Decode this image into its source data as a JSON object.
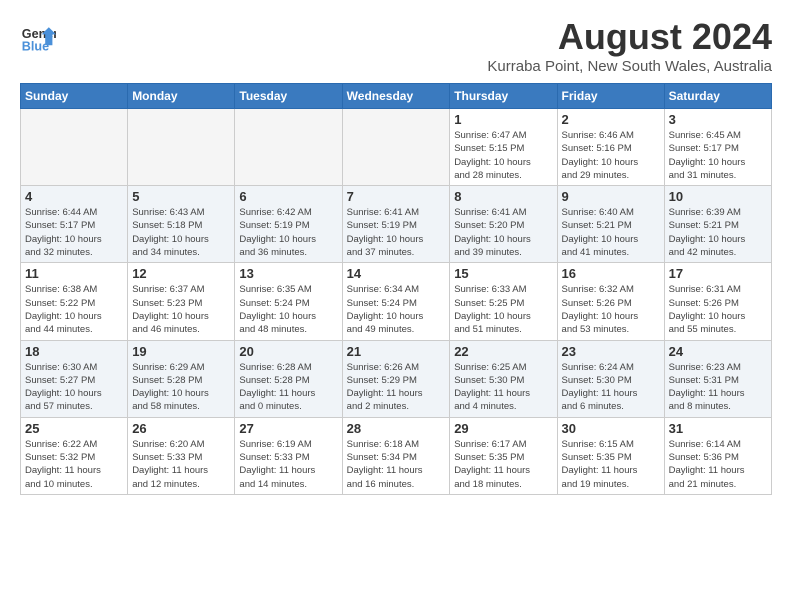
{
  "header": {
    "logo_line1": "General",
    "logo_line2": "Blue",
    "main_title": "August 2024",
    "subtitle": "Kurraba Point, New South Wales, Australia"
  },
  "calendar": {
    "days_of_week": [
      "Sunday",
      "Monday",
      "Tuesday",
      "Wednesday",
      "Thursday",
      "Friday",
      "Saturday"
    ],
    "weeks": [
      [
        {
          "day": "",
          "info": ""
        },
        {
          "day": "",
          "info": ""
        },
        {
          "day": "",
          "info": ""
        },
        {
          "day": "",
          "info": ""
        },
        {
          "day": "1",
          "info": "Sunrise: 6:47 AM\nSunset: 5:15 PM\nDaylight: 10 hours\nand 28 minutes."
        },
        {
          "day": "2",
          "info": "Sunrise: 6:46 AM\nSunset: 5:16 PM\nDaylight: 10 hours\nand 29 minutes."
        },
        {
          "day": "3",
          "info": "Sunrise: 6:45 AM\nSunset: 5:17 PM\nDaylight: 10 hours\nand 31 minutes."
        }
      ],
      [
        {
          "day": "4",
          "info": "Sunrise: 6:44 AM\nSunset: 5:17 PM\nDaylight: 10 hours\nand 32 minutes."
        },
        {
          "day": "5",
          "info": "Sunrise: 6:43 AM\nSunset: 5:18 PM\nDaylight: 10 hours\nand 34 minutes."
        },
        {
          "day": "6",
          "info": "Sunrise: 6:42 AM\nSunset: 5:19 PM\nDaylight: 10 hours\nand 36 minutes."
        },
        {
          "day": "7",
          "info": "Sunrise: 6:41 AM\nSunset: 5:19 PM\nDaylight: 10 hours\nand 37 minutes."
        },
        {
          "day": "8",
          "info": "Sunrise: 6:41 AM\nSunset: 5:20 PM\nDaylight: 10 hours\nand 39 minutes."
        },
        {
          "day": "9",
          "info": "Sunrise: 6:40 AM\nSunset: 5:21 PM\nDaylight: 10 hours\nand 41 minutes."
        },
        {
          "day": "10",
          "info": "Sunrise: 6:39 AM\nSunset: 5:21 PM\nDaylight: 10 hours\nand 42 minutes."
        }
      ],
      [
        {
          "day": "11",
          "info": "Sunrise: 6:38 AM\nSunset: 5:22 PM\nDaylight: 10 hours\nand 44 minutes."
        },
        {
          "day": "12",
          "info": "Sunrise: 6:37 AM\nSunset: 5:23 PM\nDaylight: 10 hours\nand 46 minutes."
        },
        {
          "day": "13",
          "info": "Sunrise: 6:35 AM\nSunset: 5:24 PM\nDaylight: 10 hours\nand 48 minutes."
        },
        {
          "day": "14",
          "info": "Sunrise: 6:34 AM\nSunset: 5:24 PM\nDaylight: 10 hours\nand 49 minutes."
        },
        {
          "day": "15",
          "info": "Sunrise: 6:33 AM\nSunset: 5:25 PM\nDaylight: 10 hours\nand 51 minutes."
        },
        {
          "day": "16",
          "info": "Sunrise: 6:32 AM\nSunset: 5:26 PM\nDaylight: 10 hours\nand 53 minutes."
        },
        {
          "day": "17",
          "info": "Sunrise: 6:31 AM\nSunset: 5:26 PM\nDaylight: 10 hours\nand 55 minutes."
        }
      ],
      [
        {
          "day": "18",
          "info": "Sunrise: 6:30 AM\nSunset: 5:27 PM\nDaylight: 10 hours\nand 57 minutes."
        },
        {
          "day": "19",
          "info": "Sunrise: 6:29 AM\nSunset: 5:28 PM\nDaylight: 10 hours\nand 58 minutes."
        },
        {
          "day": "20",
          "info": "Sunrise: 6:28 AM\nSunset: 5:28 PM\nDaylight: 11 hours\nand 0 minutes."
        },
        {
          "day": "21",
          "info": "Sunrise: 6:26 AM\nSunset: 5:29 PM\nDaylight: 11 hours\nand 2 minutes."
        },
        {
          "day": "22",
          "info": "Sunrise: 6:25 AM\nSunset: 5:30 PM\nDaylight: 11 hours\nand 4 minutes."
        },
        {
          "day": "23",
          "info": "Sunrise: 6:24 AM\nSunset: 5:30 PM\nDaylight: 11 hours\nand 6 minutes."
        },
        {
          "day": "24",
          "info": "Sunrise: 6:23 AM\nSunset: 5:31 PM\nDaylight: 11 hours\nand 8 minutes."
        }
      ],
      [
        {
          "day": "25",
          "info": "Sunrise: 6:22 AM\nSunset: 5:32 PM\nDaylight: 11 hours\nand 10 minutes."
        },
        {
          "day": "26",
          "info": "Sunrise: 6:20 AM\nSunset: 5:33 PM\nDaylight: 11 hours\nand 12 minutes."
        },
        {
          "day": "27",
          "info": "Sunrise: 6:19 AM\nSunset: 5:33 PM\nDaylight: 11 hours\nand 14 minutes."
        },
        {
          "day": "28",
          "info": "Sunrise: 6:18 AM\nSunset: 5:34 PM\nDaylight: 11 hours\nand 16 minutes."
        },
        {
          "day": "29",
          "info": "Sunrise: 6:17 AM\nSunset: 5:35 PM\nDaylight: 11 hours\nand 18 minutes."
        },
        {
          "day": "30",
          "info": "Sunrise: 6:15 AM\nSunset: 5:35 PM\nDaylight: 11 hours\nand 19 minutes."
        },
        {
          "day": "31",
          "info": "Sunrise: 6:14 AM\nSunset: 5:36 PM\nDaylight: 11 hours\nand 21 minutes."
        }
      ]
    ]
  }
}
